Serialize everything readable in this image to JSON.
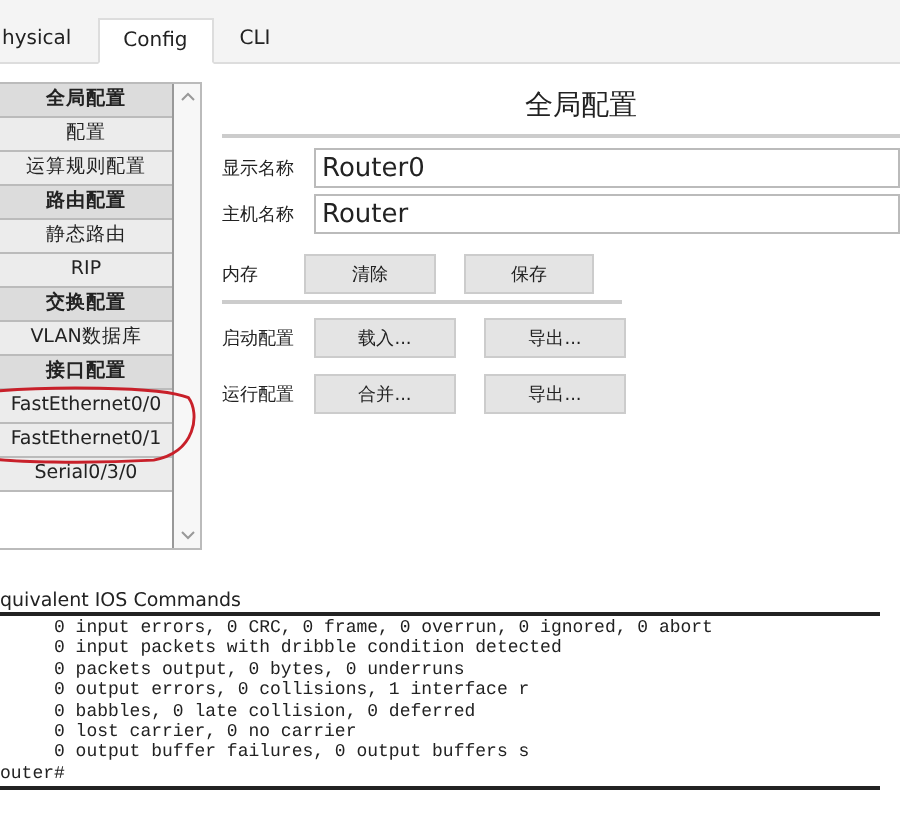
{
  "tabs": [
    {
      "label": "hysical",
      "selected": false
    },
    {
      "label": "Config",
      "selected": true
    },
    {
      "label": "CLI",
      "selected": false
    }
  ],
  "sidebar": {
    "items": [
      {
        "label": "全局配置",
        "kind": "header"
      },
      {
        "label": "配置",
        "kind": "item"
      },
      {
        "label": "运算规则配置",
        "kind": "item"
      },
      {
        "label": "路由配置",
        "kind": "header"
      },
      {
        "label": "静态路由",
        "kind": "item"
      },
      {
        "label": "RIP",
        "kind": "item"
      },
      {
        "label": "交换配置",
        "kind": "header"
      },
      {
        "label": "VLAN数据库",
        "kind": "item"
      },
      {
        "label": "接口配置",
        "kind": "header"
      },
      {
        "label": "FastEthernet0/0",
        "kind": "item"
      },
      {
        "label": "FastEthernet0/1",
        "kind": "item"
      },
      {
        "label": "Serial0/3/0",
        "kind": "item"
      }
    ]
  },
  "panel": {
    "title": "全局配置",
    "fields": [
      {
        "label": "显示名称",
        "value": "Router0"
      },
      {
        "label": "主机名称",
        "value": "Router"
      }
    ],
    "button_rows": [
      {
        "label": "内存",
        "buttons": [
          "清除",
          "保存"
        ],
        "divider_after": true
      },
      {
        "label": "启动配置",
        "buttons": [
          "载入...",
          "导出..."
        ],
        "divider_after": false
      },
      {
        "label": "运行配置",
        "buttons": [
          "合并...",
          "导出..."
        ],
        "divider_after": false
      }
    ]
  },
  "console": {
    "title": "quivalent IOS Commands",
    "lines": [
      "     0 input errors, 0 CRC, 0 frame, 0 overrun, 0 ignored, 0 abort",
      "     0 input packets with dribble condition detected",
      "     0 packets output, 0 bytes, 0 underruns",
      "     0 output errors, 0 collisions, 1 interface r",
      "     0 babbles, 0 late collision, 0 deferred",
      "     0 lost carrier, 0 no carrier",
      "     0 output buffer failures, 0 output buffers s",
      "outer#"
    ]
  }
}
